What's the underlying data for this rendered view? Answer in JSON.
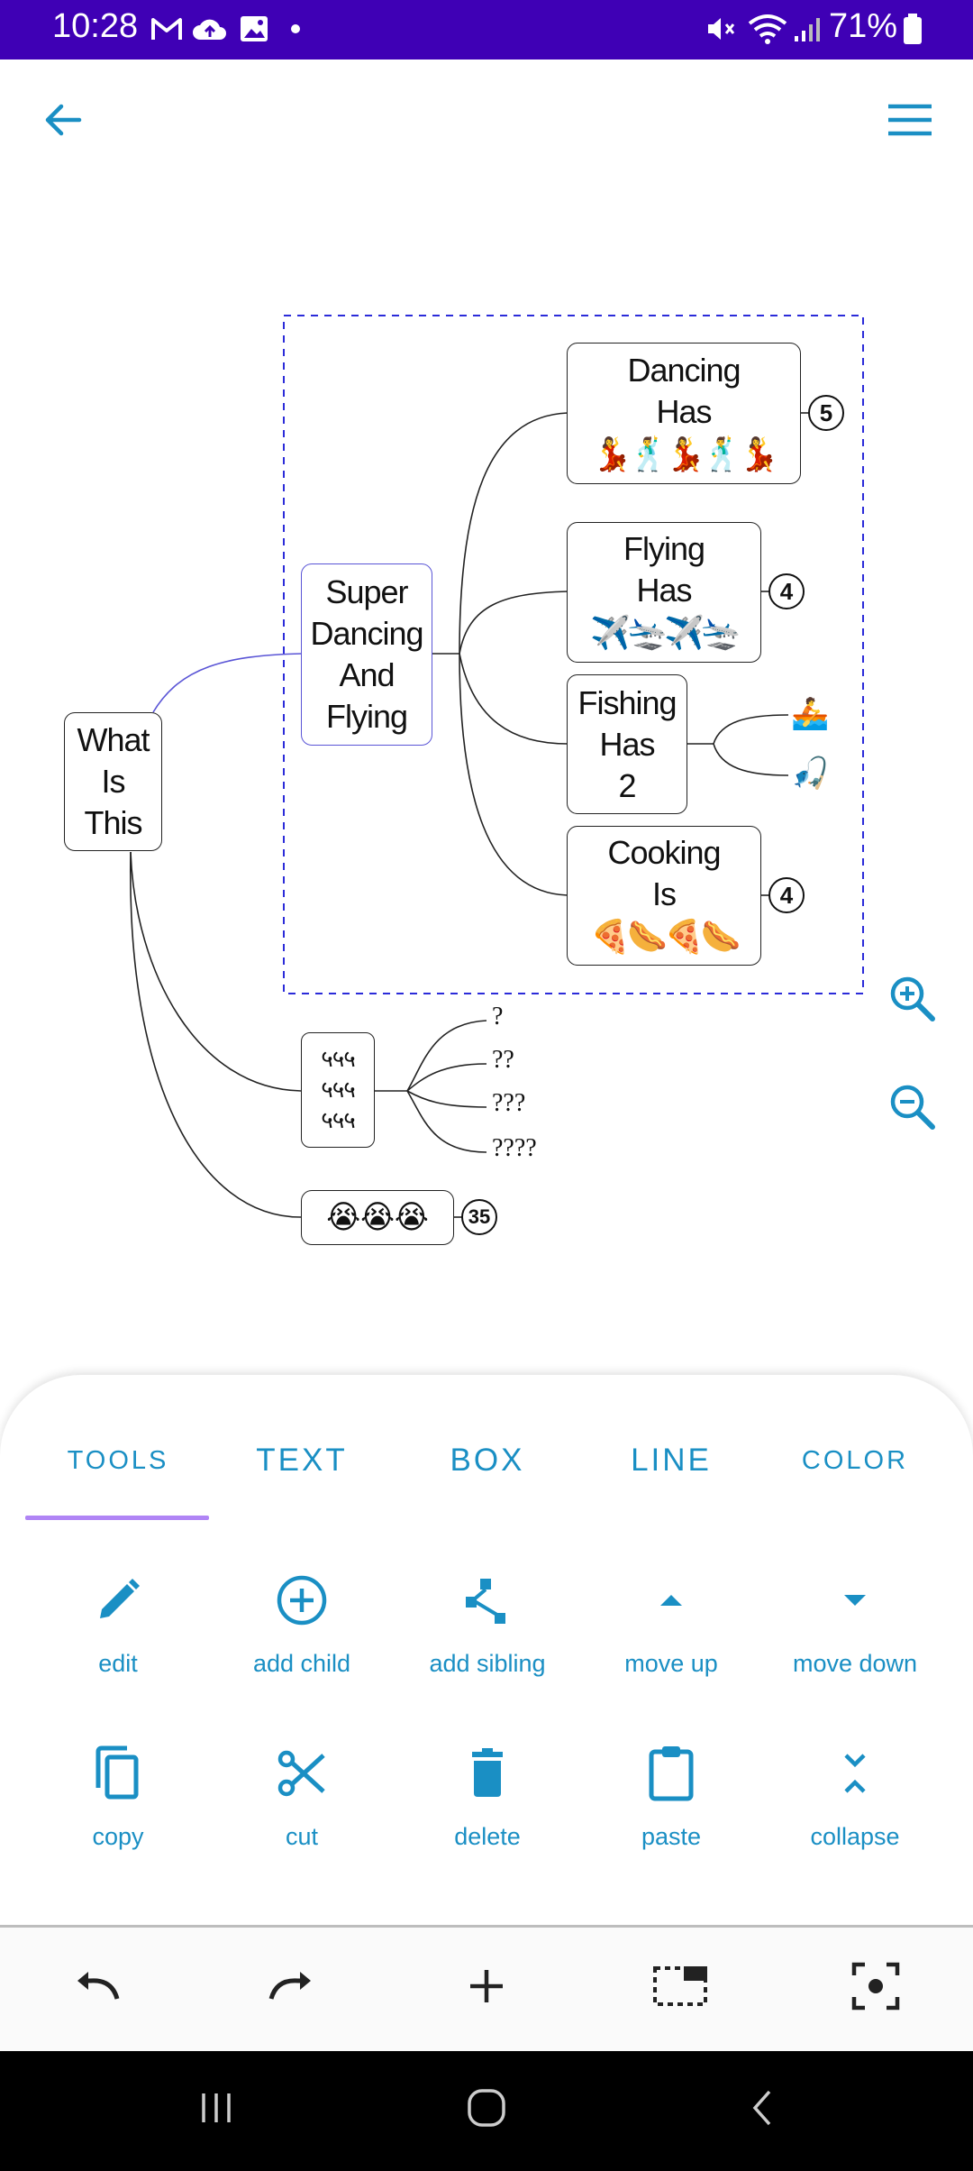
{
  "status_bar": {
    "time": "10:28",
    "battery_percent": "71%",
    "left_icons": [
      "gmail-icon",
      "cloud-upload-icon",
      "gallery-icon",
      "dot-icon"
    ],
    "right_icons": [
      "mute-icon",
      "wifi-icon",
      "signal-icon",
      "battery-icon"
    ],
    "background_color": "#3f00b5"
  },
  "app_bar": {
    "back_icon": "arrow-left-icon",
    "menu_icon": "hamburger-menu-icon",
    "accent_color": "#1a8fc4"
  },
  "mind_map": {
    "root": {
      "lines": [
        "What",
        "Is",
        "This"
      ]
    },
    "main_topic": {
      "lines": [
        "Super",
        "Dancing",
        "And",
        "Flying"
      ],
      "border_color": "#5a55d6"
    },
    "selection_border_color": "#2b2bd9",
    "topics": [
      {
        "id": "dancing",
        "lines": [
          "Dancing",
          "Has"
        ],
        "emoji": "💃🕺💃🕺💃",
        "badge": "5"
      },
      {
        "id": "flying",
        "lines": [
          "Flying",
          "Has"
        ],
        "emoji": "✈️🛬✈️🛬",
        "badge": "4"
      },
      {
        "id": "fishing",
        "lines": [
          "Fishing",
          "Has",
          "2"
        ],
        "emoji": "",
        "badge": ""
      },
      {
        "id": "cooking",
        "lines": [
          "Cooking",
          "Is"
        ],
        "emoji": "🍕🌭🍕🌭",
        "badge": "4"
      }
    ],
    "fishing_children": [
      "🚣",
      "🎣"
    ],
    "scribble_node": {
      "lines": [
        "५५५",
        "५५५",
        "५५५"
      ]
    },
    "scribble_children": [
      "?",
      "??",
      "???",
      "????"
    ],
    "crying_node": {
      "emoji": "😭😭😭",
      "badge": "35"
    }
  },
  "zoom": {
    "in_icon": "zoom-in-icon",
    "out_icon": "zoom-out-icon"
  },
  "bottom_sheet": {
    "tabs": [
      {
        "label": "TOOLS",
        "active": true
      },
      {
        "label": "TEXT",
        "active": false
      },
      {
        "label": "BOX",
        "active": false
      },
      {
        "label": "LINE",
        "active": false
      },
      {
        "label": "COLOR",
        "active": false
      }
    ],
    "tools": [
      {
        "label": "edit",
        "icon": "pencil-icon"
      },
      {
        "label": "add child",
        "icon": "add-circle-icon"
      },
      {
        "label": "add sibling",
        "icon": "share-icon"
      },
      {
        "label": "move up",
        "icon": "caret-up-icon"
      },
      {
        "label": "move down",
        "icon": "caret-down-icon"
      },
      {
        "label": "copy",
        "icon": "copy-icon"
      },
      {
        "label": "cut",
        "icon": "scissors-icon"
      },
      {
        "label": "delete",
        "icon": "trash-icon"
      },
      {
        "label": "paste",
        "icon": "clipboard-icon"
      },
      {
        "label": "collapse",
        "icon": "collapse-icon"
      }
    ],
    "indicator_color": "#b085f5"
  },
  "bottom_toolbar": {
    "icons": [
      "undo-icon",
      "redo-icon",
      "plus-icon",
      "select-area-icon",
      "focus-center-icon"
    ]
  },
  "nav_bar": {
    "icons": [
      "recent-apps-icon",
      "home-icon",
      "back-icon"
    ]
  }
}
